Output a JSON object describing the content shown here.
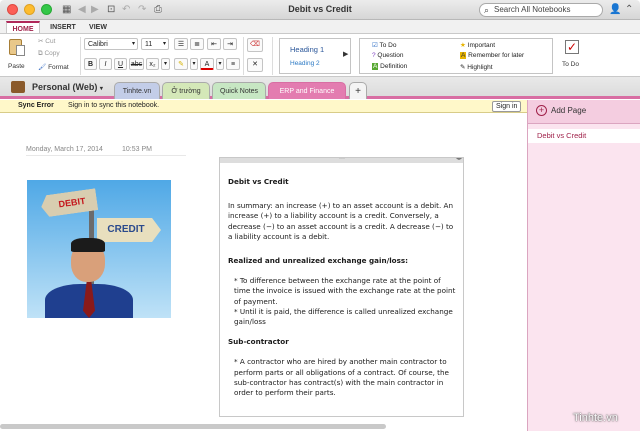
{
  "window": {
    "title": "Debit vs Credit",
    "search_placeholder": "Search All Notebooks"
  },
  "ribbon_tabs": [
    "HOME",
    "INSERT",
    "VIEW"
  ],
  "clipboard": {
    "paste": "Paste",
    "cut": "Cut",
    "copy": "Copy",
    "format": "Format"
  },
  "font": {
    "family": "Calibri",
    "size": "11"
  },
  "styles": {
    "h1": "Heading 1",
    "h2": "Heading 2"
  },
  "tags": {
    "todo": "To Do",
    "question": "Question",
    "definition": "Definition",
    "important": "Important",
    "remember": "Remember for later",
    "highlight": "Highlight",
    "todo_button": "To Do"
  },
  "notebook": {
    "name": "Personal (Web)",
    "sections": [
      "Tinhte.vn",
      "Ở trường",
      "Quick Notes",
      "ERP and Finance"
    ],
    "add": "+"
  },
  "sync": {
    "error": "Sync Error",
    "message": "Sign in to sync this notebook.",
    "signin": "Sign in"
  },
  "pages": {
    "add_label": "Add Page",
    "items": [
      "Debit vs Credit"
    ]
  },
  "note": {
    "date": "Monday, March 17, 2014",
    "time": "10:53 PM",
    "image_labels": {
      "debit": "DEBIT",
      "credit": "CREDIT"
    },
    "title": "Debit vs Credit",
    "summary": "In summary: an increase (+) to an asset account is a debit. An increase (+) to a liability account is a credit. Conversely, a decrease (−) to an asset account is a credit. A decrease (−) to a liability account is a debit.",
    "heading2": "Realized and unrealized exchange gain/loss:",
    "bullet1": "* To difference between the exchange rate at the point of time the invoice is issued with the exchange rate at the point of payment.",
    "bullet2": "* Until it is paid, the difference  is called  unrealized exchange gain/loss",
    "heading3": "Sub-contractor",
    "bullet3": "* A contractor who are hired by another main contractor to perform parts or all obligations of a contract. Of course, the sub-contractor has contract(s) with the main contractor in order to perform their parts."
  },
  "watermark": "Tinhte.vn",
  "colors": {
    "accent": "#b0285a",
    "section_tinhte": "#c3cde8",
    "section_otruong": "#d4e8b8",
    "section_quick": "#c7e7c3",
    "section_erp": "#e37cb0"
  }
}
